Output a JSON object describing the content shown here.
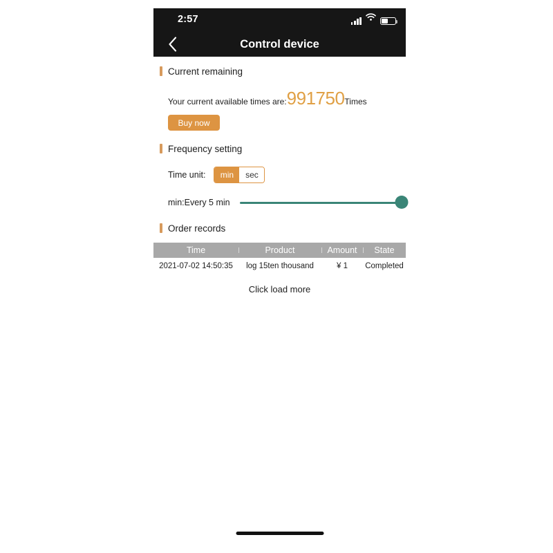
{
  "status_bar": {
    "time": "2:57",
    "signal_icon": "signal-bars-icon",
    "wifi_icon": "wifi-icon",
    "battery_icon": "battery-icon",
    "battery_level_percent": 42
  },
  "nav": {
    "back_icon": "chevron-left-icon",
    "title": "Control device"
  },
  "remaining": {
    "section_title": "Current remaining",
    "label": "Your current available times are:",
    "value": "991750",
    "unit": "Times",
    "buy_label": "Buy now"
  },
  "frequency": {
    "section_title": "Frequency setting",
    "unit_label": "Time unit:",
    "options": [
      {
        "label": "min",
        "selected": true
      },
      {
        "label": "sec",
        "selected": false
      }
    ],
    "slider_label": "min:Every 5 min",
    "slider_percent": 100
  },
  "orders": {
    "section_title": "Order records",
    "columns": [
      "Time",
      "Product",
      "Amount",
      "State"
    ],
    "rows": [
      {
        "time": "2021-07-02 14:50:35",
        "product": "log 15ten thousand",
        "amount": "¥ 1",
        "state": "Completed"
      }
    ],
    "load_more_label": "Click load more"
  },
  "colors": {
    "accent_orange": "#dd9442",
    "value_orange": "#e0a045",
    "slider_teal": "#3a8577",
    "table_header_gray": "#a8a8a8",
    "header_dark": "#161616"
  }
}
